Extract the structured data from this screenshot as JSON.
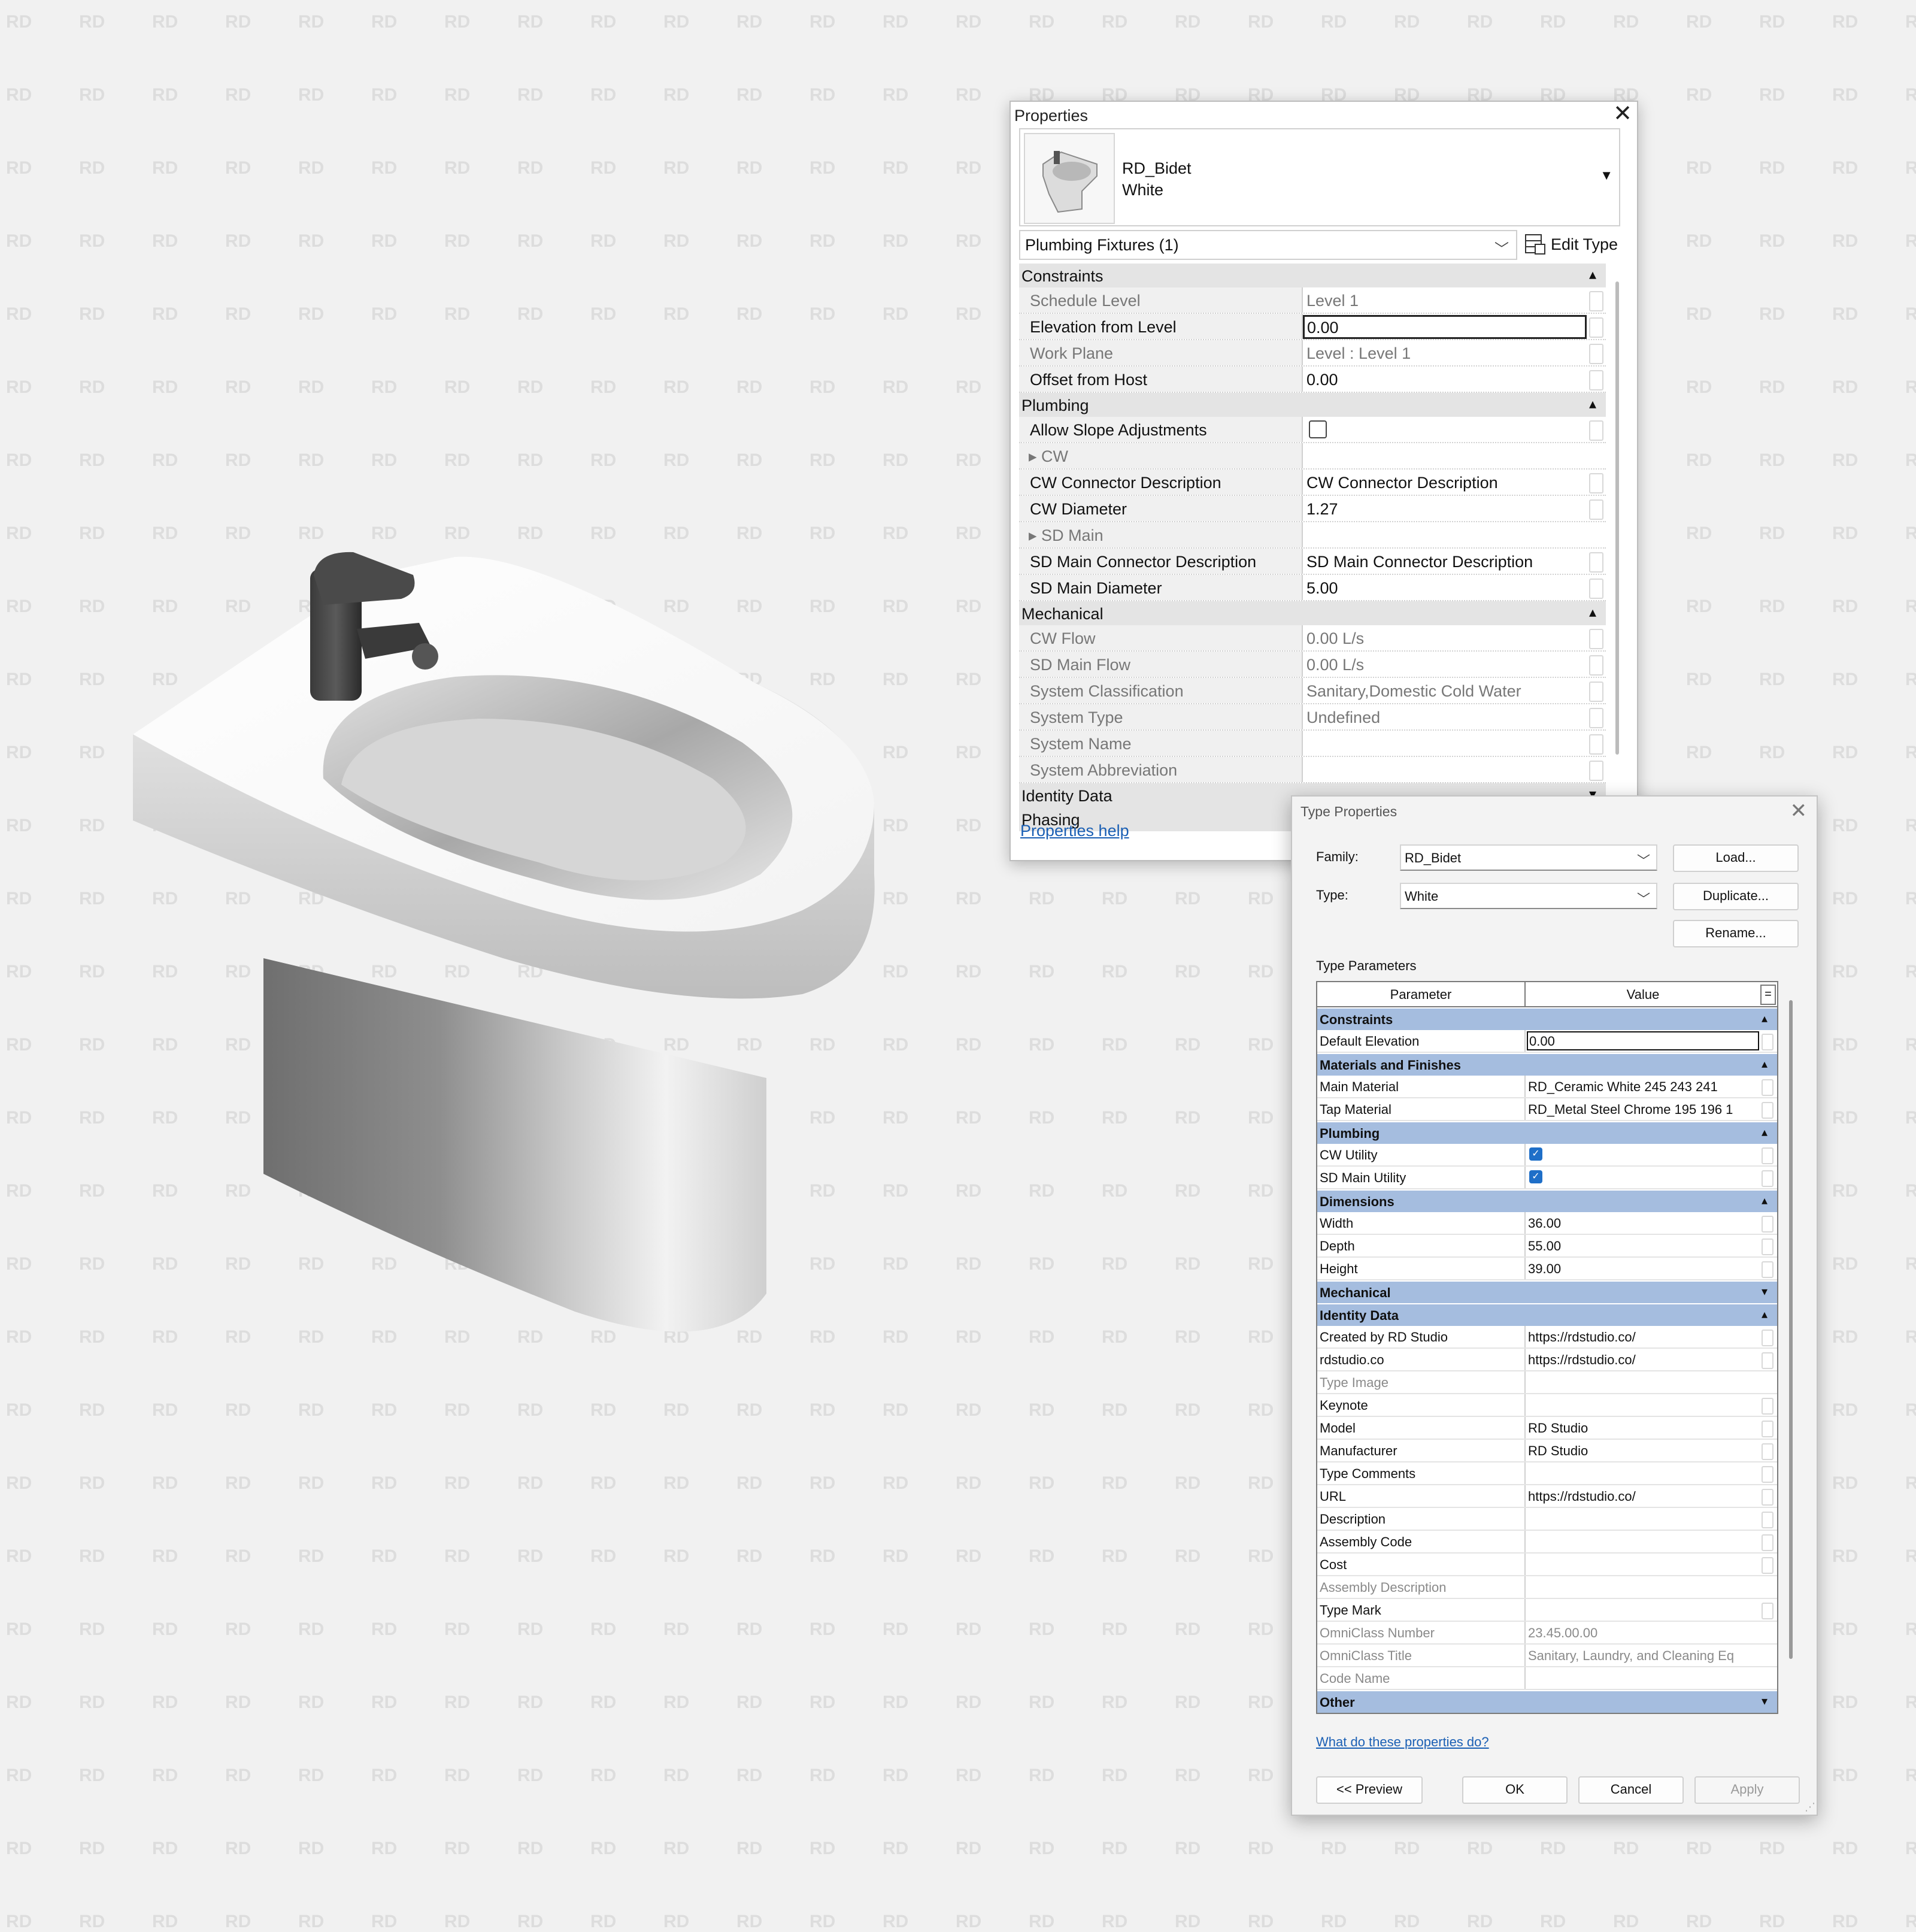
{
  "watermark": "RD",
  "properties": {
    "title": "Properties",
    "family": "RD_Bidet",
    "type": "White",
    "filter": "Plumbing Fixtures (1)",
    "edit_type": "Edit Type",
    "help": "Properties help",
    "groups": [
      {
        "name": "Constraints",
        "collapsed": false,
        "rows": [
          {
            "name": "Schedule Level",
            "value": "Level 1",
            "readonly": true
          },
          {
            "name": "Elevation from Level",
            "value": "0.00",
            "editing": true
          },
          {
            "name": "Work Plane",
            "value": "Level : Level 1",
            "readonly": true
          },
          {
            "name": "Offset from Host",
            "value": "0.00"
          }
        ]
      },
      {
        "name": "Plumbing",
        "collapsed": false,
        "rows": [
          {
            "name": "Allow Slope Adjustments",
            "checkbox": true
          },
          {
            "name": "▸ CW",
            "value": "",
            "sub": true
          },
          {
            "name": "CW Connector Description",
            "value": "CW Connector Description"
          },
          {
            "name": "CW Diameter",
            "value": "1.27"
          },
          {
            "name": "▸ SD Main",
            "value": "",
            "sub": true
          },
          {
            "name": "SD Main Connector Description",
            "value": "SD Main Connector Description"
          },
          {
            "name": "SD Main Diameter",
            "value": "5.00"
          }
        ]
      },
      {
        "name": "Mechanical",
        "collapsed": false,
        "rows": [
          {
            "name": "CW Flow",
            "value": "0.00 L/s",
            "readonly": true
          },
          {
            "name": "SD Main Flow",
            "value": "0.00 L/s",
            "readonly": true
          },
          {
            "name": "System Classification",
            "value": "Sanitary,Domestic Cold Water",
            "readonly": true
          },
          {
            "name": "System Type",
            "value": "Undefined",
            "readonly": true
          },
          {
            "name": "System Name",
            "value": "",
            "readonly": true
          },
          {
            "name": "System Abbreviation",
            "value": "",
            "readonly": true
          }
        ]
      },
      {
        "name": "Identity Data",
        "collapsed": true,
        "rows": []
      },
      {
        "name": "Phasing",
        "collapsed": true,
        "rows": [],
        "no_chevron": true
      }
    ]
  },
  "type_properties": {
    "title": "Type Properties",
    "family_label": "Family:",
    "family_value": "RD_Bidet",
    "type_label": "Type:",
    "type_value": "White",
    "load": "Load...",
    "duplicate": "Duplicate...",
    "rename": "Rename...",
    "section_label": "Type Parameters",
    "col_parameter": "Parameter",
    "col_value": "Value",
    "groups": [
      {
        "name": "Constraints",
        "collapsed": false,
        "rows": [
          {
            "name": "Default Elevation",
            "value": "0.00",
            "editing": true
          }
        ]
      },
      {
        "name": "Materials and Finishes",
        "collapsed": false,
        "rows": [
          {
            "name": "Main Material",
            "value": "RD_Ceramic White 245 243 241"
          },
          {
            "name": "Tap Material",
            "value": "RD_Metal Steel Chrome 195 196 1"
          }
        ]
      },
      {
        "name": "Plumbing",
        "collapsed": false,
        "rows": [
          {
            "name": "CW Utility",
            "checked": true
          },
          {
            "name": "SD Main Utility",
            "checked": true
          }
        ]
      },
      {
        "name": "Dimensions",
        "collapsed": false,
        "rows": [
          {
            "name": "Width",
            "value": "36.00"
          },
          {
            "name": "Depth",
            "value": "55.00"
          },
          {
            "name": "Height",
            "value": "39.00"
          }
        ]
      },
      {
        "name": "Mechanical",
        "collapsed": true,
        "rows": []
      },
      {
        "name": "Identity Data",
        "collapsed": false,
        "rows": [
          {
            "name": "Created by RD Studio",
            "value": "https://rdstudio.co/"
          },
          {
            "name": "rdstudio.co",
            "value": "https://rdstudio.co/"
          },
          {
            "name": "Type Image",
            "value": "",
            "readonly": true
          },
          {
            "name": "Keynote",
            "value": ""
          },
          {
            "name": "Model",
            "value": "RD Studio"
          },
          {
            "name": "Manufacturer",
            "value": "RD Studio"
          },
          {
            "name": "Type Comments",
            "value": ""
          },
          {
            "name": "URL",
            "value": "https://rdstudio.co/"
          },
          {
            "name": "Description",
            "value": ""
          },
          {
            "name": "Assembly Code",
            "value": ""
          },
          {
            "name": "Cost",
            "value": ""
          },
          {
            "name": "Assembly Description",
            "value": "",
            "readonly": true
          },
          {
            "name": "Type Mark",
            "value": ""
          },
          {
            "name": "OmniClass Number",
            "value": "23.45.00.00",
            "readonly": true
          },
          {
            "name": "OmniClass Title",
            "value": "Sanitary, Laundry, and Cleaning Eq",
            "readonly": true
          },
          {
            "name": "Code Name",
            "value": "",
            "readonly": true
          }
        ]
      },
      {
        "name": "Other",
        "collapsed": true,
        "rows": []
      }
    ],
    "help_link": "What do these properties do?",
    "preview": "<< Preview",
    "ok": "OK",
    "cancel": "Cancel",
    "apply": "Apply"
  }
}
